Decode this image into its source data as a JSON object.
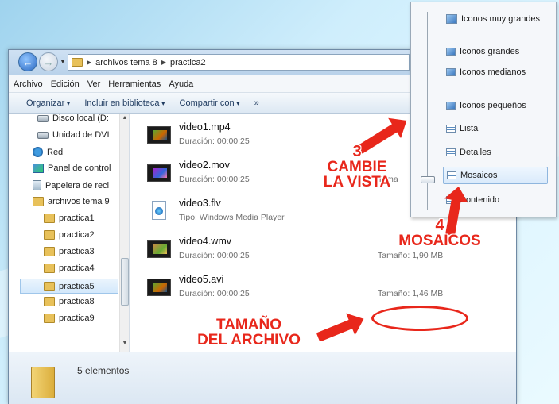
{
  "address": {
    "crumbs": [
      "archivos tema 8",
      "practica2"
    ]
  },
  "menubar": [
    "Archivo",
    "Edición",
    "Ver",
    "Herramientas",
    "Ayuda"
  ],
  "toolbar": {
    "organize": "Organizar",
    "include": "Incluir en biblioteca",
    "share": "Compartir con",
    "more": "»"
  },
  "nav": [
    {
      "label": "Disco local (D:",
      "icon": "drive-icon"
    },
    {
      "label": "Unidad de DVI",
      "icon": "dvd-drive-icon"
    },
    {
      "label": "Red",
      "icon": "network-icon"
    },
    {
      "label": "Panel de control",
      "icon": "control-panel-icon"
    },
    {
      "label": "Papelera de reci",
      "icon": "recycle-bin-icon"
    },
    {
      "label": "archivos tema 9",
      "icon": "folder-icon"
    },
    {
      "label": "practica1",
      "icon": "folder-icon"
    },
    {
      "label": "practica2",
      "icon": "folder-icon"
    },
    {
      "label": "practica3",
      "icon": "folder-icon"
    },
    {
      "label": "practica4",
      "icon": "folder-icon"
    },
    {
      "label": "practica5",
      "icon": "folder-icon",
      "selected": true
    },
    {
      "label": "practica8",
      "icon": "folder-icon"
    },
    {
      "label": "practica9",
      "icon": "folder-icon"
    }
  ],
  "files": [
    {
      "name": "video1.mp4",
      "meta": "Duración: 00:00:25",
      "size": "ama"
    },
    {
      "name": "video2.mov",
      "meta": "Duración: 00:00:25",
      "size": "Tama"
    },
    {
      "name": "video3.flv",
      "meta": "Tipo: Windows Media Player",
      "size": ""
    },
    {
      "name": "video4.wmv",
      "meta": "Duración: 00:00:25",
      "size": "Tamaño: 1,90 MB"
    },
    {
      "name": "video5.avi",
      "meta": "Duración: 00:00:25",
      "size": "Tamaño: 1,46 MB"
    }
  ],
  "status": {
    "count": "5 elementos"
  },
  "view_menu": [
    "Iconos muy grandes",
    "Iconos grandes",
    "Iconos medianos",
    "Iconos pequeños",
    "Lista",
    "Detalles",
    "Mosaicos",
    "Contenido"
  ],
  "annotations": {
    "step3_num": "3",
    "step3_line1": "CAMBIE",
    "step3_line2": "LA VISTA",
    "step4_num": "4",
    "step4_text": "MOSAICOS",
    "size_line1": "TAMAÑO",
    "size_line2": "DEL ARCHIVO",
    "color": "#e8271b"
  }
}
